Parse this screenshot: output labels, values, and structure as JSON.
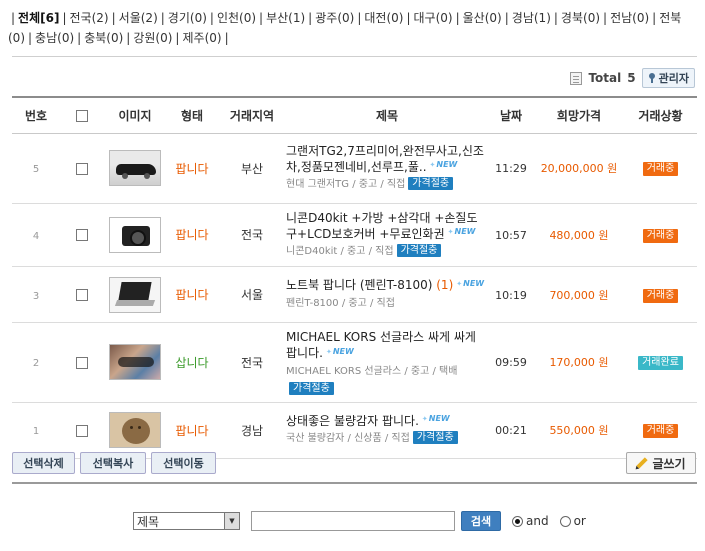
{
  "regions": [
    {
      "label": "전체",
      "count": "[6]",
      "active": true
    },
    {
      "label": "전국",
      "count": "(2)"
    },
    {
      "label": "서울",
      "count": "(2)"
    },
    {
      "label": "경기",
      "count": "(0)"
    },
    {
      "label": "인천",
      "count": "(0)"
    },
    {
      "label": "부산",
      "count": "(1)"
    },
    {
      "label": "광주",
      "count": "(0)"
    },
    {
      "label": "대전",
      "count": "(0)"
    },
    {
      "label": "대구",
      "count": "(0)"
    },
    {
      "label": "울산",
      "count": "(0)"
    },
    {
      "label": "경남",
      "count": "(1)"
    },
    {
      "label": "경북",
      "count": "(0)"
    },
    {
      "label": "전남",
      "count": "(0)"
    },
    {
      "label": "전북",
      "count": "(0)"
    },
    {
      "label": "충남",
      "count": "(0)"
    },
    {
      "label": "충북",
      "count": "(0)"
    },
    {
      "label": "강원",
      "count": "(0)"
    },
    {
      "label": "제주",
      "count": "(0)"
    }
  ],
  "summary": {
    "total_label": "Total",
    "total_value": "5",
    "admin_label": "관리자"
  },
  "columns": [
    "번호",
    "",
    "이미지",
    "형태",
    "거래지역",
    "제목",
    "날짜",
    "희망가격",
    "거래상황"
  ],
  "rows": [
    {
      "num": "5",
      "thumb": "car",
      "type": "팝니다",
      "type_kind": "sell",
      "region": "부산",
      "title": "그랜저TG2,7프리미어,완전무사고,신조차,정품모젠네비,선루프,풀..",
      "comments": "",
      "new_badge": "NEW",
      "sub": "현대 그랜저TG / 중고 / 직접",
      "nego": "가격절충",
      "time": "11:29",
      "price": "20,000,000 원",
      "status": "거래중",
      "status_kind": "ing"
    },
    {
      "num": "4",
      "thumb": "camera",
      "type": "팝니다",
      "type_kind": "sell",
      "region": "전국",
      "title": "니콘D40kit +가방 +삼각대 +손질도구+LCD보호커버 +무료인화권",
      "comments": "",
      "new_badge": "NEW",
      "sub": "니콘D40kit / 중고 / 직접",
      "nego": "가격절충",
      "time": "10:57",
      "price": "480,000 원",
      "status": "거래중",
      "status_kind": "ing"
    },
    {
      "num": "3",
      "thumb": "notebook",
      "type": "팝니다",
      "type_kind": "sell",
      "region": "서울",
      "title": "노트북 팝니다 (펜린T-8100)",
      "comments": "(1)",
      "new_badge": "NEW",
      "sub": "펜린T-8100 / 중고 / 직접",
      "nego": "",
      "time": "10:19",
      "price": "700,000 원",
      "status": "거래중",
      "status_kind": "ing"
    },
    {
      "num": "2",
      "thumb": "glasses",
      "type": "삽니다",
      "type_kind": "buy",
      "region": "전국",
      "title": "MICHAEL KORS 선글라스 싸게 싸게 팝니다.",
      "comments": "",
      "new_badge": "NEW",
      "sub": "MICHAEL KORS 선글라스 / 중고 / 택배",
      "nego": "가격절충",
      "time": "09:59",
      "price": "170,000 원",
      "status": "거래완료",
      "status_kind": "done"
    },
    {
      "num": "1",
      "thumb": "pot",
      "type": "팝니다",
      "type_kind": "sell",
      "region": "경남",
      "title": "상태좋은 불량감자 팝니다.",
      "comments": "",
      "new_badge": "NEW",
      "sub": "국산 불량감자 / 신상품 / 직접",
      "nego": "가격절충",
      "time": "00:21",
      "price": "550,000 원",
      "status": "거래중",
      "status_kind": "ing"
    }
  ],
  "buttons": {
    "delete": "선택삭제",
    "copy": "선택복사",
    "move": "선택이동",
    "write": "글쓰기"
  },
  "search": {
    "field": "제목",
    "button": "검색",
    "and_label": "and",
    "or_label": "or",
    "selected": "and"
  }
}
